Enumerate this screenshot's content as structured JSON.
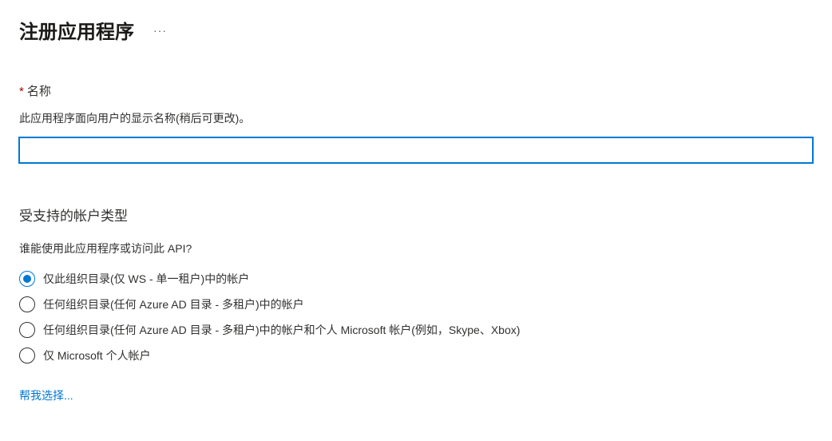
{
  "header": {
    "title": "注册应用程序",
    "more": "···"
  },
  "nameField": {
    "requiredMark": "*",
    "label": "名称",
    "help": "此应用程序面向用户的显示名称(稍后可更改)。",
    "value": ""
  },
  "accountTypes": {
    "heading": "受支持的帐户类型",
    "question": "谁能使用此应用程序或访问此 API?",
    "options": [
      {
        "label": "仅此组织目录(仅 WS - 单一租户)中的帐户",
        "selected": true
      },
      {
        "label": "任何组织目录(任何 Azure AD 目录 - 多租户)中的帐户",
        "selected": false
      },
      {
        "label": "任何组织目录(任何 Azure AD 目录 - 多租户)中的帐户和个人 Microsoft 帐户(例如，Skype、Xbox)",
        "selected": false
      },
      {
        "label": "仅 Microsoft 个人帐户",
        "selected": false
      }
    ]
  },
  "helpLink": "帮我选择..."
}
